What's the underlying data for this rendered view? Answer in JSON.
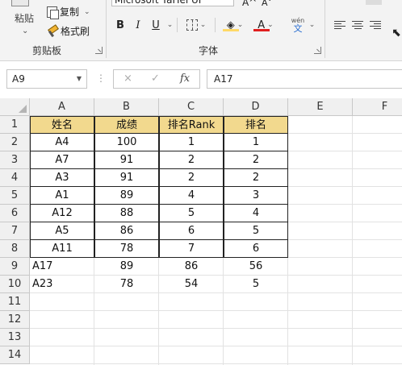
{
  "ribbon": {
    "paste_label": "粘贴",
    "copy_label": "复制",
    "format_painter_label": "格式刷",
    "clipboard_group_label": "剪贴板",
    "font_name": "Microsoft YaHei UI",
    "bold": "B",
    "italic": "I",
    "underline": "U",
    "font_color_letter": "A",
    "wen_label": "wén",
    "wen_char": "文",
    "font_group_label": "字体",
    "font_color_bar": "#e01e1e",
    "fill_color_bar": "#ffd966"
  },
  "formula_bar": {
    "name_box": "A9",
    "cancel_icon": "×",
    "enter_icon": "✓",
    "fx_label": "fx",
    "formula": "A17"
  },
  "sheet": {
    "columns": [
      "A",
      "B",
      "C",
      "D",
      "E",
      "F"
    ],
    "rows": [
      "1",
      "2",
      "3",
      "4",
      "5",
      "6",
      "7",
      "8",
      "9",
      "10",
      "11",
      "12",
      "13",
      "14"
    ],
    "header": [
      "姓名",
      "成绩",
      "排名Rank",
      "排名"
    ],
    "table": [
      [
        "A4",
        "100",
        "1",
        "1"
      ],
      [
        "A7",
        "91",
        "2",
        "2"
      ],
      [
        "A3",
        "91",
        "2",
        "2"
      ],
      [
        "A1",
        "89",
        "4",
        "3"
      ],
      [
        "A12",
        "88",
        "5",
        "4"
      ],
      [
        "A5",
        "86",
        "6",
        "5"
      ],
      [
        "A11",
        "78",
        "7",
        "6"
      ]
    ],
    "extra": [
      [
        "A17",
        "89",
        "86",
        "56"
      ],
      [
        "A23",
        "78",
        "54",
        "5"
      ]
    ],
    "header_fill": "#f2d98e"
  }
}
